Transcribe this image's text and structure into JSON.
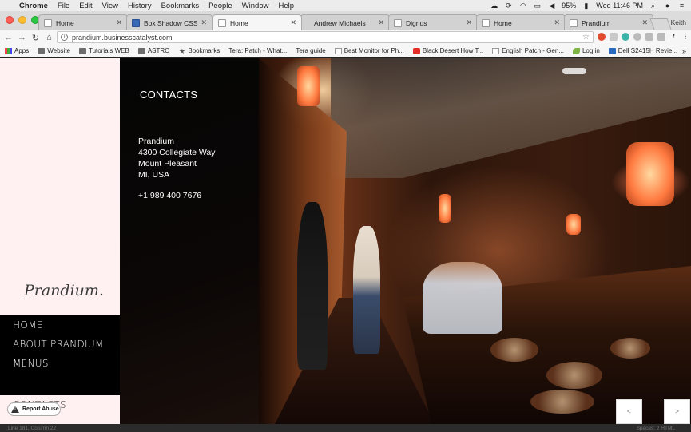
{
  "menubar": {
    "app": "Chrome",
    "items": [
      "File",
      "Edit",
      "View",
      "History",
      "Bookmarks",
      "People",
      "Window",
      "Help"
    ],
    "battery": "95%",
    "clock": "Wed 11:46 PM"
  },
  "tabs": [
    {
      "title": "Home"
    },
    {
      "title": "Box Shadow CSS Gen"
    },
    {
      "title": "Home"
    },
    {
      "title": "Andrew Michaels"
    },
    {
      "title": "Dignus"
    },
    {
      "title": "Home"
    },
    {
      "title": "Prandium"
    }
  ],
  "profile": "Keith",
  "address_bar": {
    "url": "prandium.businesscatalyst.com"
  },
  "bookmarks": [
    {
      "label": "Apps",
      "icon": "apps"
    },
    {
      "label": "Website",
      "icon": "folder"
    },
    {
      "label": "Tutorials WEB",
      "icon": "folder"
    },
    {
      "label": "ASTRO",
      "icon": "folder"
    },
    {
      "label": "Bookmarks",
      "icon": "star"
    },
    {
      "label": "Tera: Patch - What...",
      "icon": "page"
    },
    {
      "label": "Tera guide",
      "icon": "page"
    },
    {
      "label": "Best Monitor for Ph...",
      "icon": "doc"
    },
    {
      "label": "Black Desert How T...",
      "icon": "yt"
    },
    {
      "label": "English Patch - Gen...",
      "icon": "doc"
    },
    {
      "label": "Log in",
      "icon": "leaf"
    },
    {
      "label": "Dell S2415H Revie...",
      "icon": "dell"
    }
  ],
  "bookmarks_more": "»",
  "site": {
    "brand": "Prandium.",
    "nav": [
      "HOME",
      "ABOUT PRANDIUM",
      "MENUS"
    ],
    "nav_current": "CONTACTS",
    "report_abuse": "Report Abuse",
    "contacts": {
      "heading": "CONTACTS",
      "name": "Prandium",
      "street": "4300 Collegiate Way",
      "city": "Mount Pleasant",
      "region": "MI, USA",
      "phone": "+1 989 400 7676"
    },
    "slider": {
      "prev": "<",
      "next": ">"
    }
  },
  "status_strip": {
    "left": "Line 181, Column 22",
    "right": "Spaces: 2      HTML"
  }
}
